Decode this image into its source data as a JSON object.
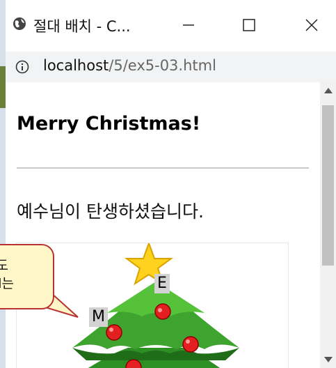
{
  "window": {
    "title": "절대 배치 - C...",
    "url_host": "localhost",
    "url_path": "/5/ex5-03.html"
  },
  "page": {
    "heading": "Merry Christmas!",
    "paragraph": "예수님이 탄생하셨습니다.",
    "ornament_e": "E",
    "ornament_m": "M"
  },
  "callout": {
    "line1": "도",
    "line2": "l는"
  },
  "icons": {
    "site": "globe-icon",
    "info": "info-icon",
    "minimize": "minimize-icon",
    "maximize": "maximize-icon",
    "close": "close-icon",
    "scroll_up": "chevron-up-icon",
    "scroll_down": "chevron-down-icon"
  },
  "colors": {
    "tree_green": "#3a9a2a",
    "ornament_red": "#e31f1f",
    "star_yellow": "#ffd21e",
    "callout_fill": "#fff7c7",
    "callout_border": "#b83232"
  }
}
